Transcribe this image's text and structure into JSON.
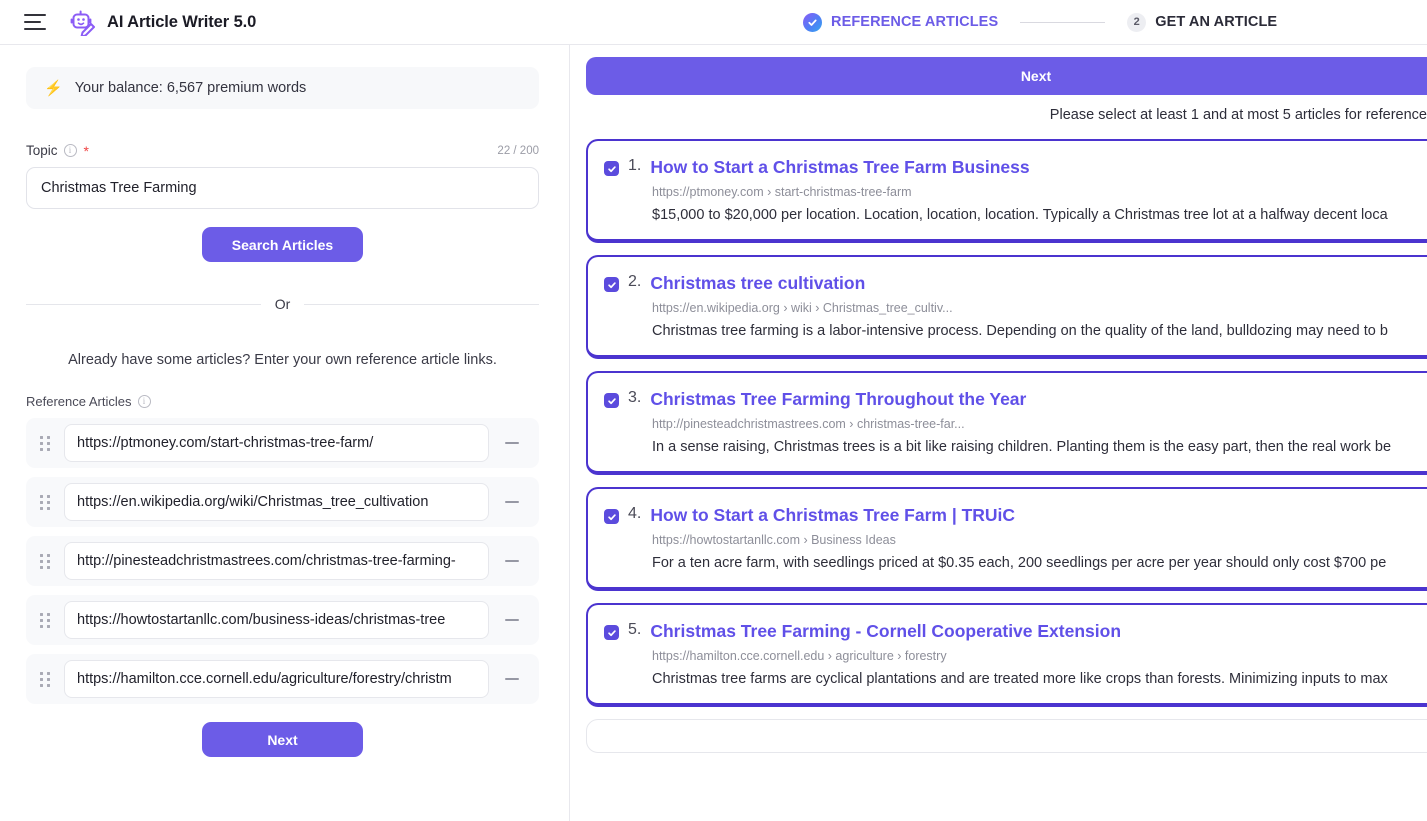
{
  "header": {
    "menu_icon": "hamburger-icon",
    "logo_icon": "robot-pen-icon",
    "title": "AI Article Writer 5.0"
  },
  "stepper": {
    "steps": [
      {
        "label": "REFERENCE ARTICLES",
        "state": "completed",
        "icon": "check-circle-icon"
      },
      {
        "label": "GET AN ARTICLE",
        "state": "current",
        "number": "2"
      }
    ]
  },
  "left_panel": {
    "balance": {
      "icon": "lightning-bolt-icon",
      "text": "Your balance: 6,567 premium words"
    },
    "topic": {
      "label": "Topic",
      "info_icon": "info-icon",
      "required_marker": "*",
      "char_count": "22 / 200",
      "value": "Christmas Tree Farming",
      "placeholder": ""
    },
    "search_button": "Search Articles",
    "divider_text": "Or",
    "hint": "Already have some articles? Enter your own reference article links.",
    "reference_articles": {
      "label": "Reference Articles",
      "info_icon": "info-icon",
      "items": [
        {
          "url": "https://ptmoney.com/start-christmas-tree-farm/",
          "handle_icon": "drag-handle-icon",
          "remove_icon": "minus-icon"
        },
        {
          "url": "https://en.wikipedia.org/wiki/Christmas_tree_cultivation",
          "handle_icon": "drag-handle-icon",
          "remove_icon": "minus-icon"
        },
        {
          "url": "http://pinesteadchristmastrees.com/christmas-tree-farming-",
          "handle_icon": "drag-handle-icon",
          "remove_icon": "minus-icon"
        },
        {
          "url": "https://howtostartanllc.com/business-ideas/christmas-tree",
          "handle_icon": "drag-handle-icon",
          "remove_icon": "minus-icon"
        },
        {
          "url": "https://hamilton.cce.cornell.edu/agriculture/forestry/christm",
          "handle_icon": "drag-handle-icon",
          "remove_icon": "minus-icon"
        }
      ]
    },
    "next_button": "Next"
  },
  "right_panel": {
    "next_button": "Next",
    "helper_text": "Please select at least 1 and at most 5 articles for reference",
    "results": [
      {
        "index": "1.",
        "checked": true,
        "title": "How to Start a Christmas Tree Farm Business",
        "url": "https://ptmoney.com › start-christmas-tree-farm",
        "snippet": "$15,000 to $20,000 per location. Location, location, location. Typically a Christmas tree lot at a halfway decent loca"
      },
      {
        "index": "2.",
        "checked": true,
        "title": "Christmas tree cultivation",
        "url": "https://en.wikipedia.org › wiki › Christmas_tree_cultiv...",
        "snippet": "Christmas tree farming is a labor-intensive process. Depending on the quality of the land, bulldozing may need to b"
      },
      {
        "index": "3.",
        "checked": true,
        "title": "Christmas Tree Farming Throughout the Year",
        "url": "http://pinesteadchristmastrees.com › christmas-tree-far...",
        "snippet": "In a sense raising, Christmas trees is a bit like raising children. Planting them is the easy part, then the real work be"
      },
      {
        "index": "4.",
        "checked": true,
        "title": "How to Start a Christmas Tree Farm | TRUiC",
        "url": "https://howtostartanllc.com › Business Ideas",
        "snippet": "For a ten acre farm, with seedlings priced at $0.35 each, 200 seedlings per acre per year should only cost $700 pe"
      },
      {
        "index": "5.",
        "checked": true,
        "title": "Christmas Tree Farming - Cornell Cooperative Extension",
        "url": "https://hamilton.cce.cornell.edu › agriculture › forestry",
        "snippet": "Christmas tree farms are cyclical plantations and are treated more like crops than forests. Minimizing inputs to max"
      }
    ]
  },
  "colors": {
    "accent": "#6c5ce7",
    "card_border": "#4b34cf",
    "link": "#6050e8",
    "required": "#ef4444"
  }
}
